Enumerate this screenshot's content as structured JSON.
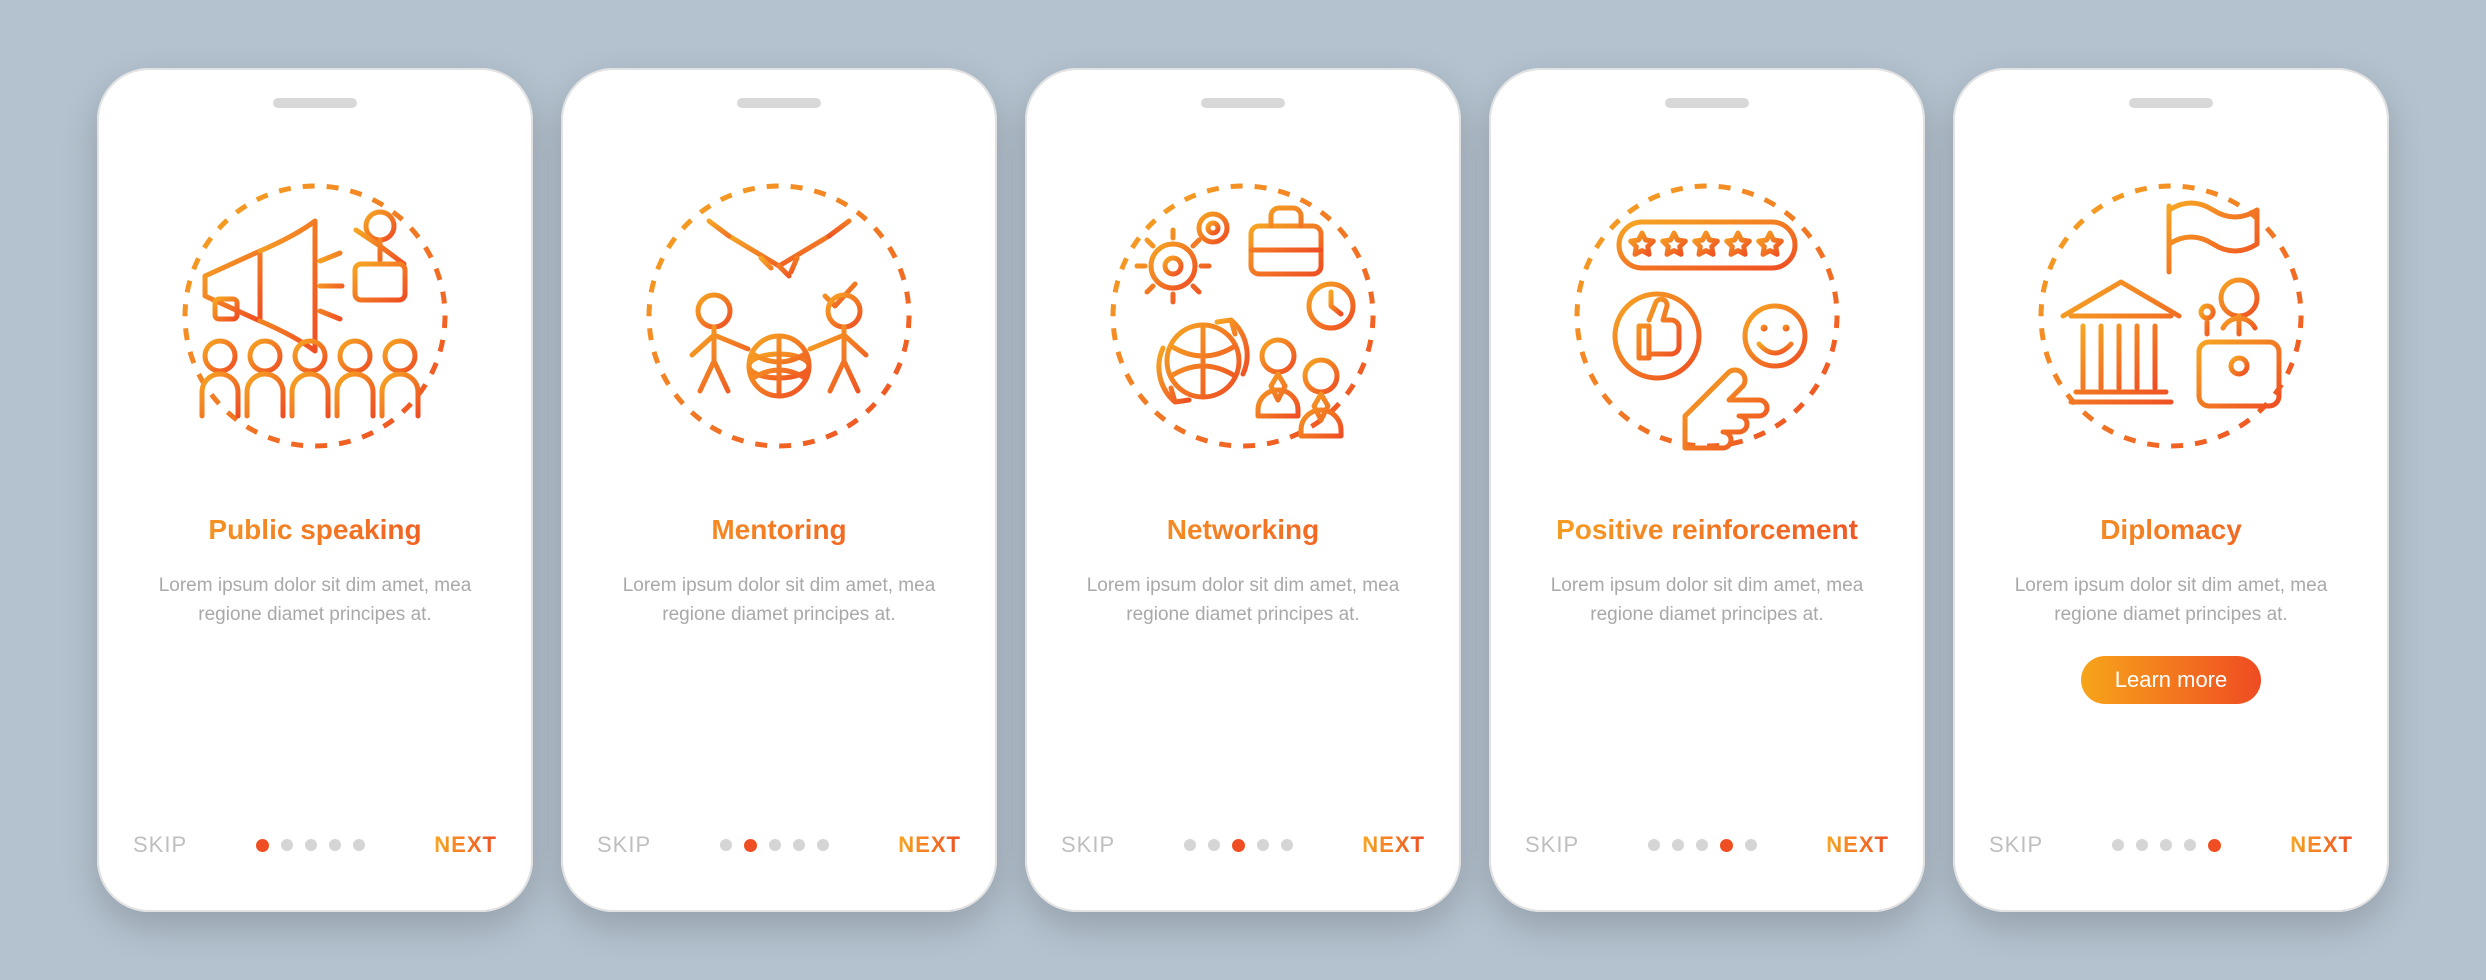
{
  "common": {
    "skip_label": "SKIP",
    "next_label": "NEXT",
    "desc": "Lorem ipsum dolor sit dim amet, mea regione diamet principes at.",
    "learn_more": "Learn more",
    "dot_count": 5,
    "colors": {
      "accent_start": "#f6a623",
      "accent_end": "#ef4e23",
      "inactive": "#d5d5d5"
    }
  },
  "screens": [
    {
      "title": "Public speaking",
      "icon": "public-speaking-icon",
      "active_index": 0,
      "has_cta": false
    },
    {
      "title": "Mentoring",
      "icon": "mentoring-icon",
      "active_index": 1,
      "has_cta": false
    },
    {
      "title": "Networking",
      "icon": "networking-icon",
      "active_index": 2,
      "has_cta": false
    },
    {
      "title": "Positive reinforcement",
      "icon": "positive-reinforcement-icon",
      "active_index": 3,
      "has_cta": false
    },
    {
      "title": "Diplomacy",
      "icon": "diplomacy-icon",
      "active_index": 4,
      "has_cta": true
    }
  ]
}
